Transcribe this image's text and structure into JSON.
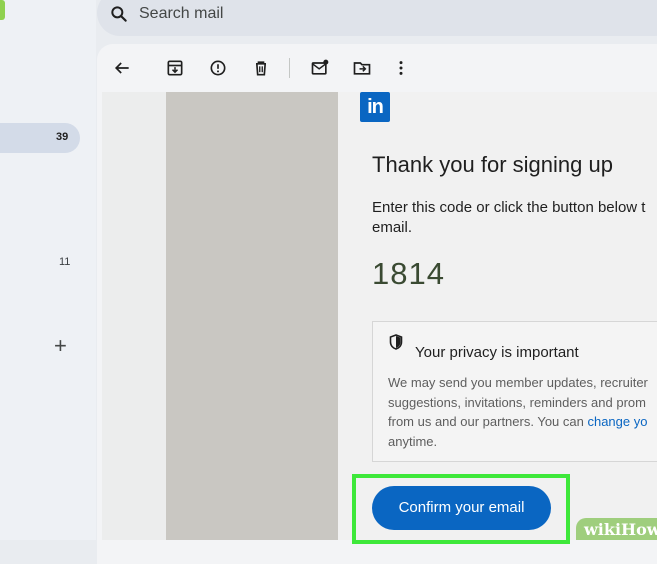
{
  "search": {
    "placeholder": "Search mail"
  },
  "sidebar": {
    "inbox_count": "39",
    "second_count": "11",
    "add_label": "+"
  },
  "toolbar": {
    "icons": [
      "back-arrow-icon",
      "archive-icon",
      "report-spam-icon",
      "delete-icon",
      "mark-unread-icon",
      "move-to-icon",
      "more-options-icon"
    ]
  },
  "email": {
    "logo_text": "in",
    "heading": "Thank you for signing up",
    "instruction_line1": "Enter this code or click the button below t",
    "instruction_line2": "email.",
    "code": "1814",
    "privacy": {
      "title": "Your privacy is important",
      "line1": "We may send you member updates, recruiter",
      "line2": "suggestions, invitations, reminders and prom",
      "line3_prefix": "from us and our partners. You can ",
      "line3_link": "change yo",
      "line4": "anytime."
    },
    "confirm_button": "Confirm your email"
  },
  "watermark": {
    "wiki": "wiki",
    "how": "How"
  },
  "colors": {
    "linkedin_blue": "#0a66c2",
    "highlight_green": "#3ee83a"
  }
}
